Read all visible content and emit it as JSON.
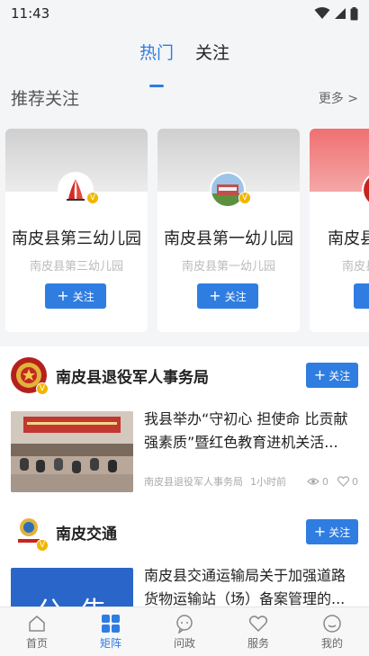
{
  "status": {
    "time": "11:43"
  },
  "tabs": [
    {
      "label": "热门",
      "active": true
    },
    {
      "label": "关注",
      "active": false
    }
  ],
  "recommend": {
    "title": "推荐关注",
    "more": "更多 >",
    "cards": [
      {
        "name": "南皮县第三幼儿园",
        "subtitle": "南皮县第三幼儿园",
        "follow": "关注"
      },
      {
        "name": "南皮县第一幼儿园",
        "subtitle": "南皮县第一幼儿园",
        "follow": "关注"
      },
      {
        "name": "南皮县",
        "subtitle": "南皮县",
        "follow": ""
      }
    ]
  },
  "feed": [
    {
      "org": "南皮县退役军人事务局",
      "follow": "关注",
      "article": {
        "title": "我县举办“守初心 担使命 比贡献 强素质”暨红色教育进机关活...",
        "source": "南皮县退役军人事务局",
        "time": "1小时前",
        "views": "0",
        "likes": "0"
      }
    },
    {
      "org": "南皮交通",
      "follow": "关注",
      "article": {
        "title": "南皮县交通运输局关于加强道路货物运输站（场）备案管理的...",
        "thumb_text": "公  告"
      }
    }
  ],
  "bottom_nav": [
    {
      "label": "首页",
      "icon": "home-icon",
      "active": false
    },
    {
      "label": "矩阵",
      "icon": "matrix-icon",
      "active": true
    },
    {
      "label": "问政",
      "icon": "chat-icon",
      "active": false
    },
    {
      "label": "服务",
      "icon": "heart-icon",
      "active": false
    },
    {
      "label": "我的",
      "icon": "profile-icon",
      "active": false
    }
  ],
  "colors": {
    "accent": "#2f7de1",
    "verified": "#f0b600"
  }
}
